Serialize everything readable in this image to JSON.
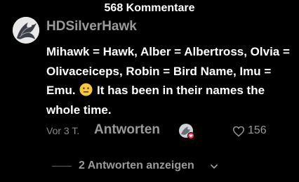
{
  "header": {
    "comment_count": "568 Kommentare"
  },
  "comment": {
    "username": "HDSilverHawk",
    "text_part1": "Mihawk = Hawk, Alber = Albertross, Olvia = Olivaceiceps, Robin = Bird Name, Imu = Emu.",
    "emoji": "neutral-face-emoji",
    "text_part2": "It has been in their names the whole time.",
    "timestamp": "Vor 3 T.",
    "reply_label": "Antworten",
    "likes": "156"
  },
  "replies": {
    "label": "2 Antworten anzeigen"
  },
  "colors": {
    "background": "#000000",
    "primary_text": "#ffffff",
    "secondary_text": "#9a9a9a",
    "emoji_yellow": "#f7c744",
    "badge_red": "#fe2c55"
  },
  "icons": {
    "like": "heart-outline-icon",
    "expand": "chevron-down-icon",
    "avatar": "silver-hawk-avatar"
  }
}
